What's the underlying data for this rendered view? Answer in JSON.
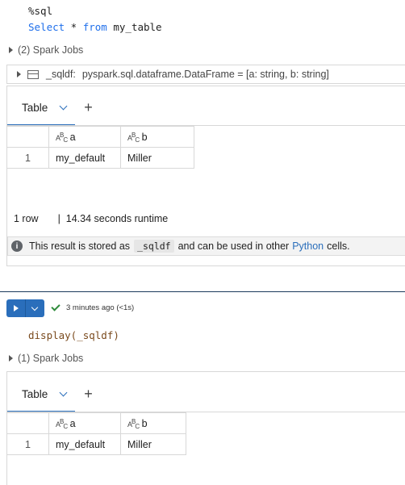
{
  "cell1": {
    "code": {
      "line1": "%sql",
      "line2_kw1": "Select",
      "line2_mid": " * ",
      "line2_kw2": "from",
      "line2_rest": " my_table"
    },
    "spark_jobs": "(2) Spark Jobs",
    "df_label": "_sqldf:",
    "df_type": "pyspark.sql.dataframe.DataFrame = [a: string, b: string]",
    "tab_label": "Table",
    "table": {
      "columns": [
        {
          "icon": "abc-type-icon",
          "name": "a"
        },
        {
          "icon": "abc-type-icon",
          "name": "b"
        }
      ],
      "rows": [
        {
          "index": "1",
          "a": "my_default",
          "b": "Miller"
        }
      ]
    },
    "footer": {
      "rows": "1 row",
      "sep": "|",
      "runtime": "14.34 seconds runtime"
    },
    "banner": {
      "pre": "This result is stored as",
      "chip": "_sqldf",
      "mid": "and can be used in other",
      "link": "Python",
      "post": "cells."
    }
  },
  "cell2": {
    "status": "3 minutes ago (<1s)",
    "code": "display(_sqldf)",
    "spark_jobs": "(1) Spark Jobs",
    "tab_label": "Table",
    "table": {
      "columns": [
        {
          "icon": "abc-type-icon",
          "name": "a"
        },
        {
          "icon": "abc-type-icon",
          "name": "b"
        }
      ],
      "rows": [
        {
          "index": "1",
          "a": "my_default",
          "b": "Miller"
        }
      ]
    }
  },
  "colors": {
    "accent": "#2a6ebb",
    "success": "#2e8b3a",
    "keyword": "#1f6feb"
  }
}
